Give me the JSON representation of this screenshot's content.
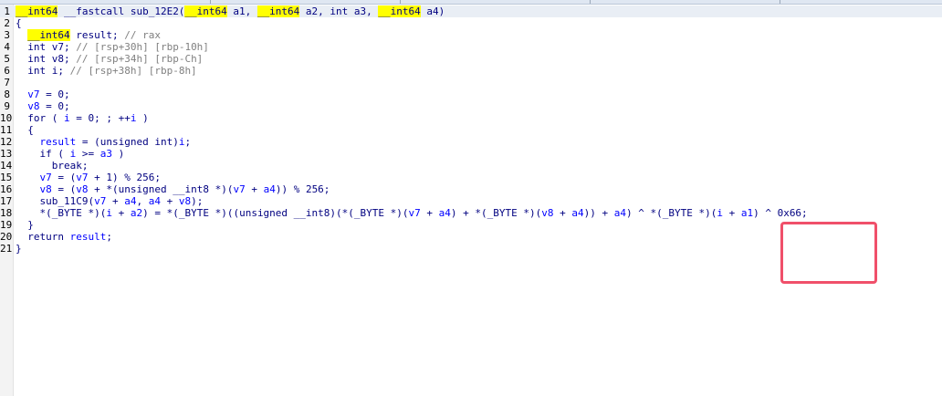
{
  "gutter": {
    "line_numbers": [
      "1",
      "2",
      "3",
      "4",
      "5",
      "6",
      "7",
      "8",
      "9",
      "10",
      "11",
      "12",
      "13",
      "14",
      "15",
      "16",
      "17",
      "18",
      "19",
      "20",
      "21"
    ]
  },
  "code": {
    "l1": {
      "t1": "__int64",
      "t2": " __fastcall sub_12E2(",
      "t3": "__int64",
      "t4": " a1, ",
      "t5": "__int64",
      "t6": " a2, int a3, ",
      "t7": "__int64",
      "t8": " a4)"
    },
    "l2": "{",
    "l3": {
      "t1": "__int64",
      "t2": " result; ",
      "t3": "// rax"
    },
    "l4": {
      "t1": "int v7; ",
      "t2": "// [rsp+30h] [rbp-10h]"
    },
    "l5": {
      "t1": "int v8; ",
      "t2": "// [rsp+34h] [rbp-Ch]"
    },
    "l6": {
      "t1": "int i; ",
      "t2": "// [rsp+38h] [rbp-8h]"
    },
    "l7": "",
    "l8": {
      "v": "v7",
      "rest": " = 0;"
    },
    "l9": {
      "v": "v8",
      "rest": " = 0;"
    },
    "l10": {
      "a": "for ( ",
      "i1": "i",
      "b": " = 0; ; ++",
      "i2": "i",
      "c": " )"
    },
    "l11": "{",
    "l12": {
      "r": "result",
      "a": " = (unsigned int)",
      "i": "i",
      "b": ";"
    },
    "l13": {
      "a": "if ( ",
      "i": "i",
      "b": " >= ",
      "a3": "a3",
      "c": " )"
    },
    "l14": "break;",
    "l15": {
      "v7a": "v7",
      "a": " = (",
      "v7b": "v7",
      "b": " + 1) % 256;"
    },
    "l16": {
      "v8a": "v8",
      "a": " = (",
      "v8b": "v8",
      "b": " + *(unsigned __int8 *)(",
      "v7": "v7",
      "c": " + ",
      "a4": "a4",
      "d": ")) % 256;"
    },
    "l17": {
      "fn": "sub_11C9",
      "a": "(",
      "v7": "v7",
      "b": " + ",
      "a4a": "a4",
      "c": ", ",
      "a4b": "a4",
      "d": " + ",
      "v8": "v8",
      "e": ");"
    },
    "l18": {
      "a": "*(_BYTE *)(",
      "i1": "i",
      "b": " + ",
      "a2": "a2",
      "c": ") = *(_BYTE *)((unsigned __int8)(*(_BYTE *)(",
      "v7": "v7",
      "d": " + ",
      "a4a": "a4",
      "e": ") + *(_BYTE *)(",
      "v8": "v8",
      "f": " + ",
      "a4b": "a4",
      "g": ")) + ",
      "a4c": "a4",
      "h": ") ^ *(_BYTE *)(",
      "i2": "i",
      "i": " + ",
      "a1": "a1",
      "j": ") ^ 0x66;"
    },
    "l19": "}",
    "l20": {
      "a": "return ",
      "r": "result",
      "b": ";"
    },
    "l21": "}"
  },
  "colors": {
    "highlight": "#ffff00",
    "annotation_box": "#f0506a",
    "keyword": "#000080",
    "variable": "#0000ff",
    "comment": "#808080"
  }
}
